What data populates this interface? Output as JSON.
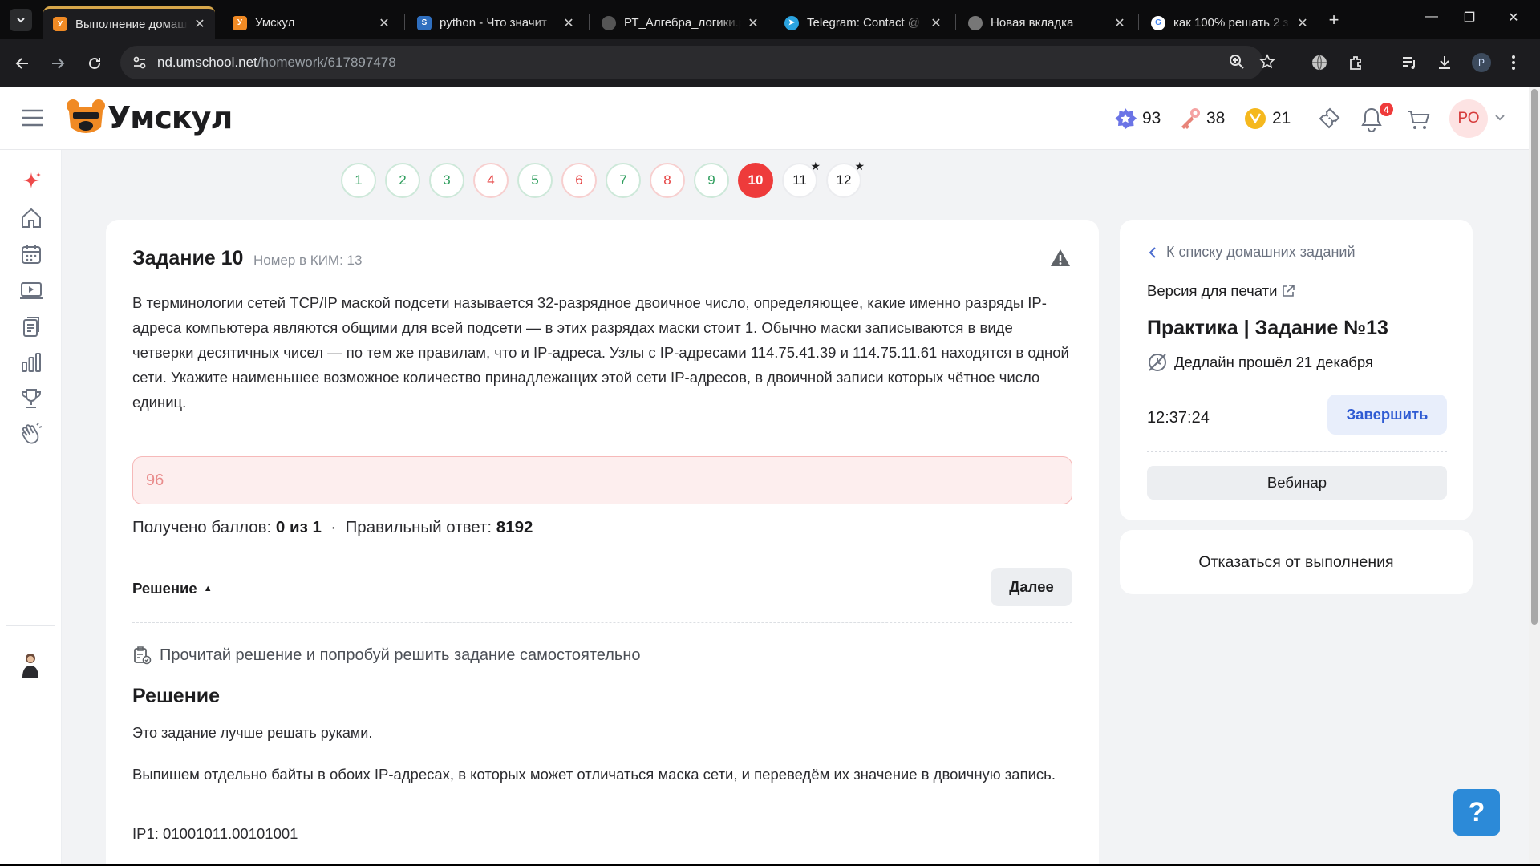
{
  "browser": {
    "tabs": [
      {
        "title": "Выполнение домашн",
        "active": true
      },
      {
        "title": "Умскул",
        "active": false
      },
      {
        "title": "python - Что значит",
        "active": false
      },
      {
        "title": "РТ_Алгебра_логики.p",
        "active": false
      },
      {
        "title": "Telegram: Contact @",
        "active": false
      },
      {
        "title": "Новая вкладка",
        "active": false
      },
      {
        "title": "как 100% решать 2 з",
        "active": false
      }
    ],
    "url_host": "nd.umschool.net",
    "url_path": "/homework/617897478",
    "profile_initial": "P"
  },
  "header": {
    "brand": "Умскул",
    "stats": {
      "stars": "93",
      "keys": "38",
      "coins": "21"
    },
    "notifications_count": "4",
    "avatar_initials": "РО"
  },
  "question_nav": [
    {
      "n": "1",
      "status": "correct"
    },
    {
      "n": "2",
      "status": "correct"
    },
    {
      "n": "3",
      "status": "correct"
    },
    {
      "n": "4",
      "status": "wrong"
    },
    {
      "n": "5",
      "status": "correct"
    },
    {
      "n": "6",
      "status": "wrong"
    },
    {
      "n": "7",
      "status": "correct"
    },
    {
      "n": "8",
      "status": "wrong"
    },
    {
      "n": "9",
      "status": "correct"
    },
    {
      "n": "10",
      "status": "current"
    },
    {
      "n": "11",
      "status": "pending",
      "star": true
    },
    {
      "n": "12",
      "status": "pending",
      "star": true
    }
  ],
  "task": {
    "title": "Задание 10",
    "kim": "Номер в КИМ: 13",
    "text": "В терминологии сетей TCP/IP маской подсети называется 32-разрядное двоичное число, определяющее, какие именно разряды IP-адреса компьютера являются общими для всей подсети — в этих разрядах маски стоит 1. Обычно маски записываются в виде четверки десятичных чисел — по тем же правилам, что и IP-адреса. Узлы с IP-адресами 114.75.41.39 и 114.75.11.61 находятся в одной сети. Укажите наименьшее возможное количество принадлежащих этой сети IP-адресов, в двоичной записи которых чётное число единиц.",
    "answer_value": "96",
    "score_label": "Получено баллов:",
    "score_value": "0 из 1",
    "separator": "·",
    "correct_label": "Правильный ответ:",
    "correct_value": "8192",
    "solution_toggle": "Решение",
    "next_button": "Далее",
    "hint": "Прочитай решение и попробуй решить задание самостоятельно",
    "solution_title": "Решение",
    "solution_link": "Это задание лучше решать руками.",
    "solution_paragraph": "Выпишем отдельно байты в обоих IP-адресах, в которых может отличаться маска сети, и переведём их значение в двоичную запись.",
    "solution_ip1": "IP1: 01001011.00101001"
  },
  "sidebar_card": {
    "back": "К списку домашних заданий",
    "print": "Версия для печати",
    "title": "Практика | Задание №13",
    "deadline": "Дедлайн прошёл 21 декабря",
    "timer": "12:37:24",
    "finish_button": "Завершить",
    "webinar_button": "Вебинар",
    "refuse": "Отказаться от выполнения"
  },
  "help_button": "?",
  "colors": {
    "accent_blue": "#2f5bd3",
    "error_red": "#ee3b3b",
    "success_green": "#2d9d5c",
    "brand_orange": "#f08a24"
  }
}
